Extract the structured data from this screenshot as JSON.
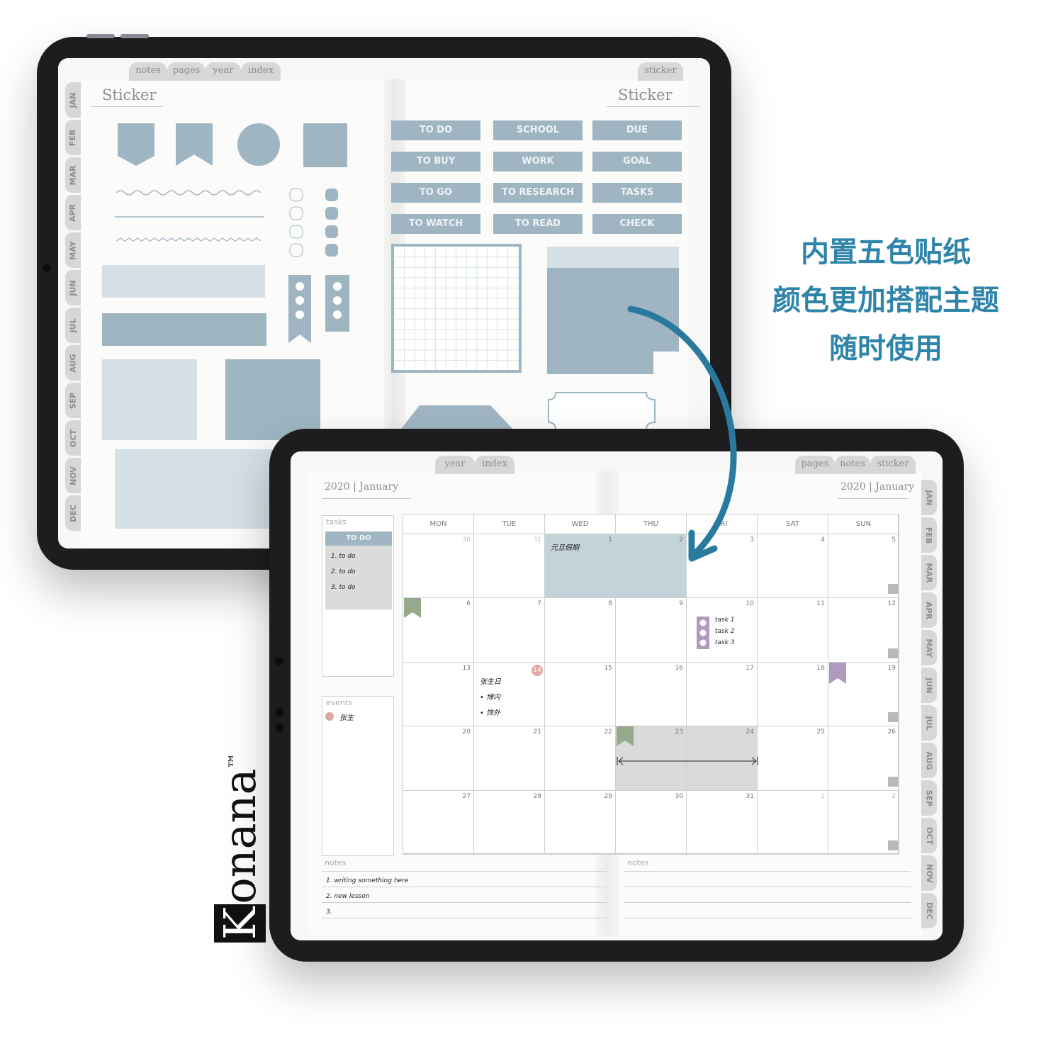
{
  "back_screen": {
    "top_tabs_left": [
      "notes",
      "pages",
      "year",
      "index"
    ],
    "top_tabs_right": [
      "sticker"
    ],
    "month_tabs": [
      "JAN",
      "FEB",
      "MAR",
      "APR",
      "MAY",
      "JUN",
      "JUL",
      "AUG",
      "SEP",
      "OCT",
      "NOV",
      "DEC"
    ],
    "title_left": "Sticker",
    "title_right": "Sticker",
    "label_stickers": [
      [
        "TO DO",
        "SCHOOL",
        "DUE"
      ],
      [
        "TO BUY",
        "WORK",
        "GOAL"
      ],
      [
        "TO GO",
        "TO RESEARCH",
        "TASKS"
      ],
      [
        "TO WATCH",
        "TO READ",
        "CHECK"
      ]
    ],
    "sticker_color": "#9fb5c2"
  },
  "front_screen": {
    "top_tabs_left": [
      "year",
      "index"
    ],
    "top_tabs_right": [
      "pages",
      "notes",
      "sticker"
    ],
    "month_tabs": [
      "JAN",
      "FEB",
      "MAR",
      "APR",
      "MAY",
      "JUN",
      "JUL",
      "AUG",
      "SEP",
      "OCT",
      "NOV",
      "DEC"
    ],
    "title_left": "2020 | January",
    "title_right": "2020 | January",
    "tasks": {
      "label": "tasks",
      "header": "TO DO",
      "items": [
        "1. to do",
        "2. to do",
        "3. to do"
      ]
    },
    "events": {
      "label": "events",
      "items": [
        "张生"
      ]
    },
    "calendar": {
      "weekdays": [
        "MON",
        "TUE",
        "WED",
        "THU",
        "FRI",
        "SAT",
        "SUN"
      ],
      "weeks": [
        [
          "30",
          "31",
          "1",
          "2",
          "3",
          "4",
          "5"
        ],
        [
          "6",
          "7",
          "8",
          "9",
          "10",
          "11",
          "12"
        ],
        [
          "13",
          "14",
          "15",
          "16",
          "17",
          "18",
          "19"
        ],
        [
          "20",
          "21",
          "22",
          "23",
          "24",
          "25",
          "26"
        ],
        [
          "27",
          "28",
          "29",
          "30",
          "31",
          "1",
          "2"
        ]
      ],
      "handwriting": {
        "holiday": "元旦假期",
        "birthday_lines": [
          "张生日",
          "• 博内",
          "• 饰外"
        ],
        "tasks_lines": [
          "task 1",
          "task 2",
          "task 3"
        ]
      }
    },
    "notes_left": {
      "label": "notes",
      "lines": [
        "1.  writing something here",
        "2.  new lesson",
        "3."
      ]
    },
    "notes_right": {
      "label": "notes"
    }
  },
  "caption": {
    "lines": [
      "内置五色贴纸",
      "颜色更加搭配主题",
      "随时使用"
    ],
    "color": "#2e85a9"
  },
  "brand": {
    "first_letter": "K",
    "rest": "onana",
    "mark": "™"
  }
}
